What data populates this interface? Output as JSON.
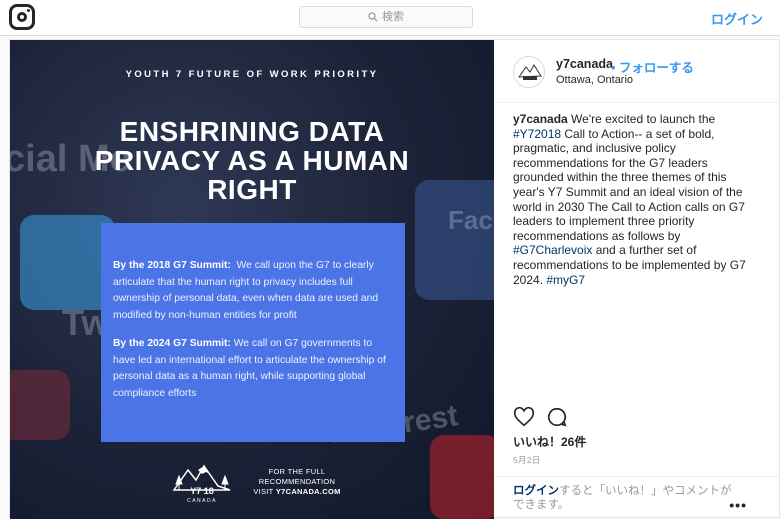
{
  "topbar": {
    "logo_icon": "instagram-camera-icon",
    "search_placeholder": "検索",
    "login_label": "ログイン"
  },
  "photo": {
    "kicker": "YOUTH 7 FUTURE OF WORK PRIORITY",
    "headline_line1": "ENSHRINING DATA",
    "headline_line2": "PRIVACY AS A HUMAN",
    "headline_line3": "RIGHT",
    "para1_lead": "By the 2018 G7 Summit:",
    "para1_body": "We call upon the G7 to clearly articulate that the human right to privacy includes full ownership of personal data, even when data are used and modified by non-human entities for profit",
    "para2_lead": "By the 2024 G7 Summit:",
    "para2_body": "We call on G7 governments to have led an international effort to articulate the ownership of personal data as a human right, while supporting global compliance efforts",
    "footer_line1": "FOR THE FULL",
    "footer_line2": "RECOMMENDATION",
    "footer_line3_prefix": "VISIT ",
    "footer_url": "Y7CANADA.COM",
    "logo_text_main": "Y7 18",
    "logo_text_sub": "CANADA",
    "bg_words": {
      "social": "cial Me",
      "twitter": "Tw",
      "face": "Fac",
      "pinterest": "Pinterest"
    },
    "box_color": "#4b74e6"
  },
  "post": {
    "username": "y7canada",
    "follow_sep": "•",
    "follow_label": "フォローする",
    "location": "Ottawa, Ontario",
    "caption": {
      "user": "y7canada",
      "text1": " We're excited to launch the ",
      "tag1": "#Y72018",
      "text2": " Call to Action-- a set of bold, pragmatic, and inclusive policy recommendations for the G7 leaders grounded within the three themes of this year's Y7 Summit and an ideal vision of the world in 2030 The Call to Action calls on G7 leaders to implement three priority recommendations as follows by ",
      "tag2": "#G7Charlevoix",
      "text3": " and a further set of recommendations to be implemented by G7 2024. ",
      "tag3": "#myG7"
    },
    "likes": "いいね！26件",
    "date": "5月2日",
    "login_link": "ログイン",
    "login_rest": "すると「いいね！」やコメントができます。",
    "more_label": "•••",
    "like_icon": "heart-icon",
    "comment_icon": "comment-icon"
  }
}
